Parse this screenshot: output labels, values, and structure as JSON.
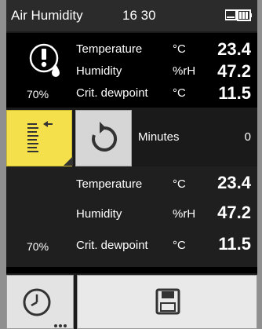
{
  "statusbar": {
    "title": "Air Humidity",
    "time": "16 30"
  },
  "top_readings": {
    "rows": [
      {
        "label": "Temperature",
        "unit": "°C",
        "value": "23.4"
      },
      {
        "label": "Humidity",
        "unit": "%rH",
        "value": "47.2"
      },
      {
        "label": "Crit. dewpoint",
        "unit": "°C",
        "value": "11.5",
        "prefix": "70%"
      }
    ],
    "icon": "humidity-alert-icon"
  },
  "toolbar": {
    "minutes_label": "Minutes",
    "minutes_value": "0",
    "left_icon": "list-menu-icon",
    "refresh_icon": "refresh-icon"
  },
  "lower_readings": {
    "rows": [
      {
        "label": "Temperature",
        "unit": "°C",
        "value": "23.4"
      },
      {
        "label": "Humidity",
        "unit": "%rH",
        "value": "47.2"
      },
      {
        "label": "Crit. dewpoint",
        "unit": "°C",
        "value": "11.5",
        "prefix": "70%"
      }
    ]
  },
  "bottom": {
    "clock_icon": "clock-icon",
    "save_icon": "floppy-save-icon"
  },
  "colors": {
    "accent_yellow": "#f3e04a",
    "screen_bg": "#000000"
  }
}
